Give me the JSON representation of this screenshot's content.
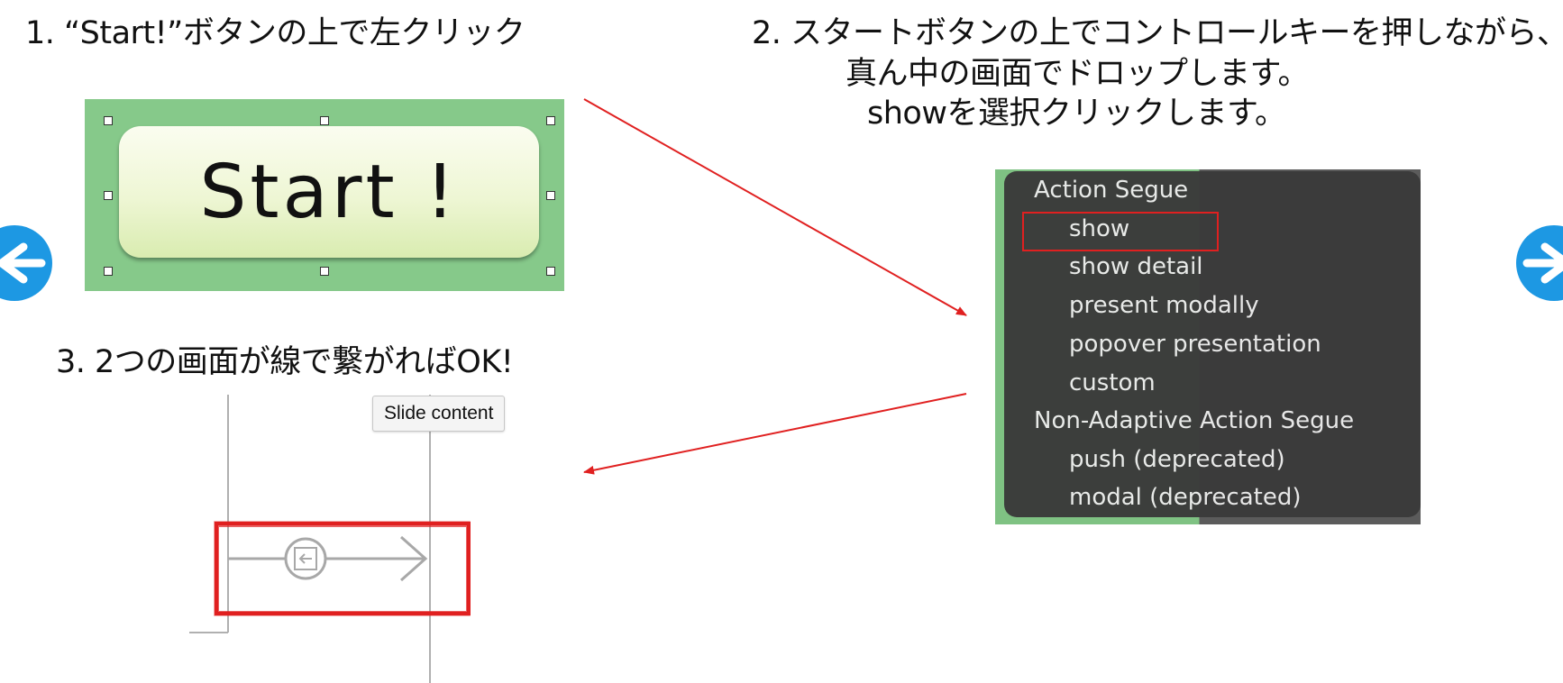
{
  "steps": {
    "step1": "1.  “Start!”ボタンの上で左クリック",
    "step2_line1": "2.  スタートボタンの上でコントロールキーを押しながら、",
    "step2_line2": "真ん中の画面でドロップします。",
    "step2_line3": "showを選択クリックします。",
    "step3": "3. 2つの画面が線で繋がればOK!"
  },
  "start_button": {
    "label": "Start !"
  },
  "segue_menu": {
    "header1": "Action Segue",
    "items1": [
      "show",
      "show detail",
      "present modally",
      "popover presentation",
      "custom"
    ],
    "header2": "Non-Adaptive Action Segue",
    "items2": [
      "push (deprecated)",
      "modal (deprecated)"
    ],
    "highlighted_item": "show"
  },
  "tooltip": {
    "text": "Slide content"
  },
  "navigation": {
    "prev_icon": "arrow-left-icon",
    "next_icon": "arrow-right-icon"
  },
  "colors": {
    "nav_arrow": "#1d98e3",
    "annotation_red": "#e02020",
    "start_panel_green": "#86c98a",
    "menu_background": "#3a3a3a"
  }
}
